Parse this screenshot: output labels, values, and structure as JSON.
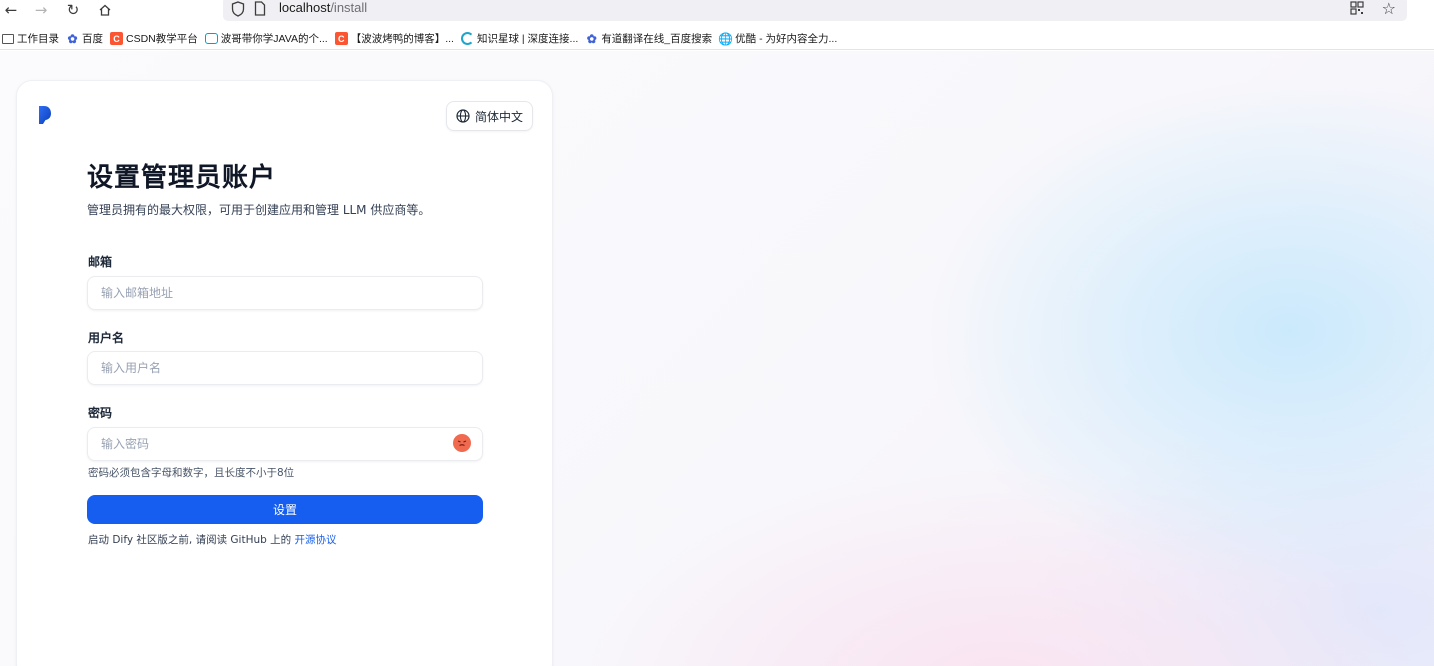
{
  "browser": {
    "url_host": "localhost",
    "url_path": "/install",
    "bookmarks": [
      {
        "label": "工作目录",
        "icon": "folder-icon"
      },
      {
        "label": "百度",
        "icon": "paw-icon"
      },
      {
        "label": "CSDN教学平台",
        "icon": "csdn-icon"
      },
      {
        "label": "波哥带你学JAVA的个...",
        "icon": "bilibili-icon"
      },
      {
        "label": "【波波烤鸭的博客】...",
        "icon": "csdn-icon"
      },
      {
        "label": "知识星球 | 深度连接...",
        "icon": "ring-icon"
      },
      {
        "label": "有道翻译在线_百度搜索",
        "icon": "paw-icon"
      },
      {
        "label": "优酷 - 为好内容全力...",
        "icon": "globe-icon"
      }
    ]
  },
  "install": {
    "language_label": "简体中文",
    "title": "设置管理员账户",
    "subtitle": "管理员拥有的最大权限，可用于创建应用和管理 LLM 供应商等。",
    "email_label": "邮箱",
    "email_placeholder": "输入邮箱地址",
    "username_label": "用户名",
    "username_placeholder": "输入用户名",
    "password_label": "密码",
    "password_placeholder": "输入密码",
    "password_hint": "密码必须包含字母和数字，且长度不小于8位",
    "submit_label": "设置",
    "license_prefix": "启动 Dify 社区版之前, 请阅读 GitHub 上的 ",
    "license_link": "开源协议"
  },
  "colors": {
    "primary": "#155eef",
    "title": "#101828",
    "link": "#155eef",
    "eye_toggle": "#f06a50"
  }
}
